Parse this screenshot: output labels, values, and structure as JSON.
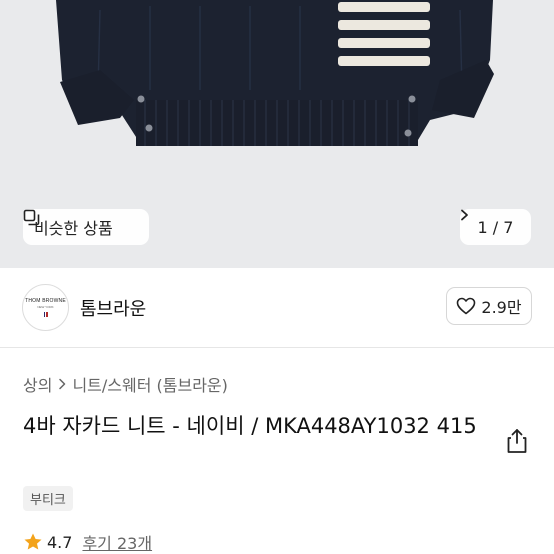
{
  "gallery": {
    "similar_label": "비슷한 상품",
    "similar_icon": "similar-items-icon",
    "pager_current": "1",
    "pager_total": "7",
    "pager_separator": "/",
    "pager_icon": "chevron-right-icon"
  },
  "brand": {
    "logo_line1": "THOM BROWNE",
    "logo_line2": "NEW YORK",
    "name": "톰브라운",
    "likes_label": "2.9만",
    "like_icon": "heart-icon"
  },
  "breadcrumb": {
    "items": [
      "상의",
      "니트/스웨터 (톰브라운)"
    ],
    "separator_icon": "chevron-right-icon"
  },
  "product": {
    "title": "4바 자카드 니트 - 네이비 / MKA448AY1032 415",
    "tag": "부티크",
    "rating": "4.7",
    "reviews_label": "후기 23개",
    "share_icon": "share-icon"
  },
  "colors": {
    "image_background": "#e9eaec",
    "sweater_navy": "#1c2230",
    "stripe_ivory": "#ece8df",
    "star": "#f3a31b"
  }
}
